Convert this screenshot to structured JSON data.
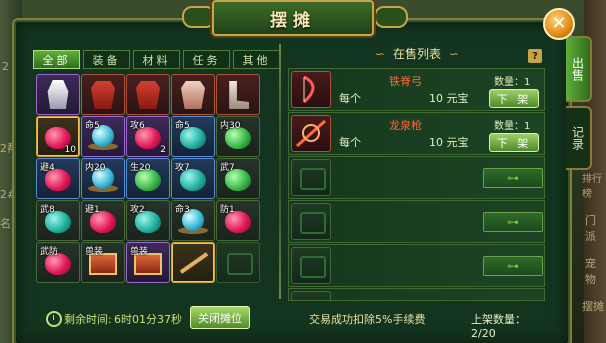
{
  "window": {
    "title": "摆摊",
    "close_label": "✕"
  },
  "side_tabs": [
    {
      "label": "出售",
      "active": true
    },
    {
      "label": "记录",
      "active": false
    }
  ],
  "background_ghost_text": [
    "2",
    "2帮",
    "2#",
    "名",
    "排行榜",
    "门派",
    "宠物",
    "摆摊"
  ],
  "category_tabs": [
    {
      "label": "全部",
      "active": true
    },
    {
      "label": "装备",
      "active": false
    },
    {
      "label": "材料",
      "active": false
    },
    {
      "label": "任务",
      "active": false
    },
    {
      "label": "其他",
      "active": false
    }
  ],
  "inventory": [
    {
      "label": "",
      "count": "",
      "icon": "helm-icon",
      "frame": "purple"
    },
    {
      "label": "",
      "count": "",
      "icon": "armor-icon",
      "frame": "red"
    },
    {
      "label": "",
      "count": "",
      "icon": "armor-icon",
      "frame": "red"
    },
    {
      "label": "",
      "count": "",
      "icon": "armor-light-icon",
      "frame": "red"
    },
    {
      "label": "",
      "count": "",
      "icon": "boots-icon",
      "frame": "red"
    },
    {
      "label": "",
      "count": "10",
      "icon": "red-gem-icon",
      "frame": "gold"
    },
    {
      "label": "命5",
      "count": "",
      "icon": "orb-icon",
      "frame": "purple"
    },
    {
      "label": "攻6",
      "count": "2",
      "icon": "red-gem-icon",
      "frame": "purple"
    },
    {
      "label": "命5",
      "count": "",
      "icon": "teal-gem-icon",
      "frame": "blue"
    },
    {
      "label": "内30",
      "count": "",
      "icon": "green-gem-icon",
      "frame": "plain"
    },
    {
      "label": "避4",
      "count": "",
      "icon": "red-gem-icon",
      "frame": "blue"
    },
    {
      "label": "内20",
      "count": "",
      "icon": "orb-icon",
      "frame": "blue"
    },
    {
      "label": "生20",
      "count": "",
      "icon": "green-gem-icon",
      "frame": "blue"
    },
    {
      "label": "攻7",
      "count": "",
      "icon": "teal-gem-icon",
      "frame": "blue"
    },
    {
      "label": "武7",
      "count": "",
      "icon": "green-gem-icon",
      "frame": "plain"
    },
    {
      "label": "武8",
      "count": "",
      "icon": "teal-gem-icon",
      "frame": "plain"
    },
    {
      "label": "避1",
      "count": "",
      "icon": "red-gem-icon",
      "frame": "plain"
    },
    {
      "label": "攻2",
      "count": "",
      "icon": "teal-gem-icon",
      "frame": "plain"
    },
    {
      "label": "命3",
      "count": "",
      "icon": "orb-icon",
      "frame": "plain"
    },
    {
      "label": "防1",
      "count": "",
      "icon": "red-gem-icon",
      "frame": "plain"
    },
    {
      "label": "武防",
      "count": "",
      "icon": "red-gem-icon",
      "frame": "plain"
    },
    {
      "label": "兽装",
      "count": "",
      "icon": "chest-icon",
      "frame": "plain"
    },
    {
      "label": "兽装",
      "count": "",
      "icon": "chest-icon",
      "frame": "purple"
    },
    {
      "label": "",
      "count": "",
      "icon": "spear-icon",
      "frame": "gold"
    },
    {
      "label": "",
      "count": "",
      "icon": "",
      "frame": "empty"
    }
  ],
  "sale_list": {
    "title": "在售列表",
    "help_label": "?",
    "rows": [
      {
        "name": "铁脊弓",
        "per_label": "每个",
        "price": "10 元宝",
        "qty": "数量：1",
        "action": "下 架",
        "icon": "bow-icon",
        "empty": false
      },
      {
        "name": "龙泉枪",
        "per_label": "每个",
        "price": "10 元宝",
        "qty": "数量：1",
        "action": "下 架",
        "icon": "spear-icon",
        "empty": false
      },
      {
        "empty": true,
        "action_icon": "add-slot-icon",
        "icon": "empty-slot-icon"
      },
      {
        "empty": true,
        "action_icon": "add-slot-icon",
        "icon": "empty-slot-icon"
      },
      {
        "empty": true,
        "action_icon": "add-slot-icon",
        "icon": "empty-slot-icon"
      },
      {
        "empty": true,
        "action_icon": "add-slot-icon",
        "icon": "empty-slot-icon"
      }
    ]
  },
  "footer": {
    "time_label": "剩余时间:",
    "time_value": "6时01分37秒",
    "close_stall_label": "关闭摊位",
    "fee_note": "交易成功扣除5%手续费",
    "shelf_count": "上架数量：2/20"
  },
  "colors": {
    "panel_bg": "#13341f",
    "frame_gold": "#c7a64b",
    "item_name_red": "#ff6a3a",
    "active_tab_green": "#5fae3a"
  }
}
